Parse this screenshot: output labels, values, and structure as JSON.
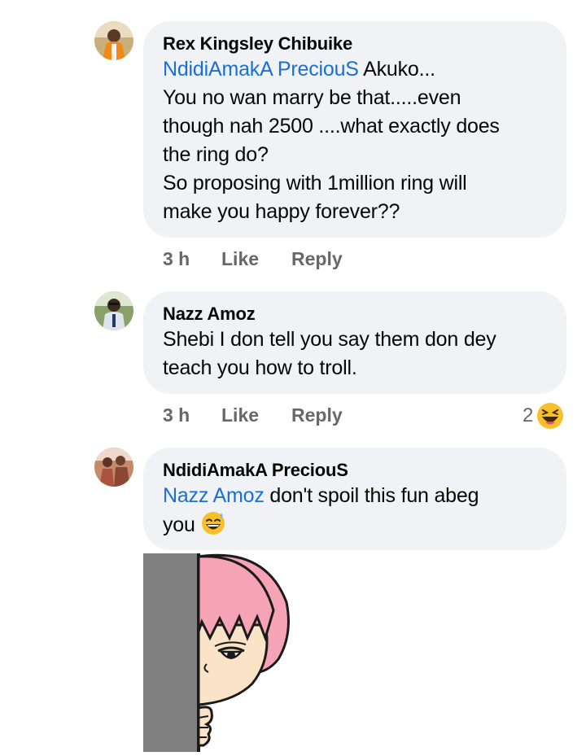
{
  "comments": [
    {
      "author": "Rex Kingsley Chibuike",
      "mention": "NdidiAmakA PreciouS",
      "line1_rest": " Akuko...",
      "lines": [
        "You no wan marry be that.....even",
        "though nah 2500 ....what exactly does",
        "the ring do?",
        "So proposing with 1million ring will",
        "make you happy forever??"
      ],
      "time": "3 h",
      "like": "Like",
      "reply": "Reply"
    },
    {
      "author": "Nazz Amoz",
      "lines": [
        "Shebi I don tell you say them don dey",
        "teach you how to troll."
      ],
      "time": "3 h",
      "like": "Like",
      "reply": "Reply",
      "reaction_count": "2",
      "reaction_icon": "laughing-emoji-icon"
    },
    {
      "author": "NdidiAmakA PreciouS",
      "mention": "Nazz Amoz",
      "line1_rest": "  don't spoil this fun abeg",
      "line2": "you",
      "emoji": "sweat-smile-emoji-icon"
    }
  ],
  "colors": {
    "bubble": "#f0f2f5",
    "mention": "#1a6fd6",
    "meta": "#65676b",
    "sticker_hair": "#f5a3b5",
    "sticker_wall": "#808080"
  }
}
